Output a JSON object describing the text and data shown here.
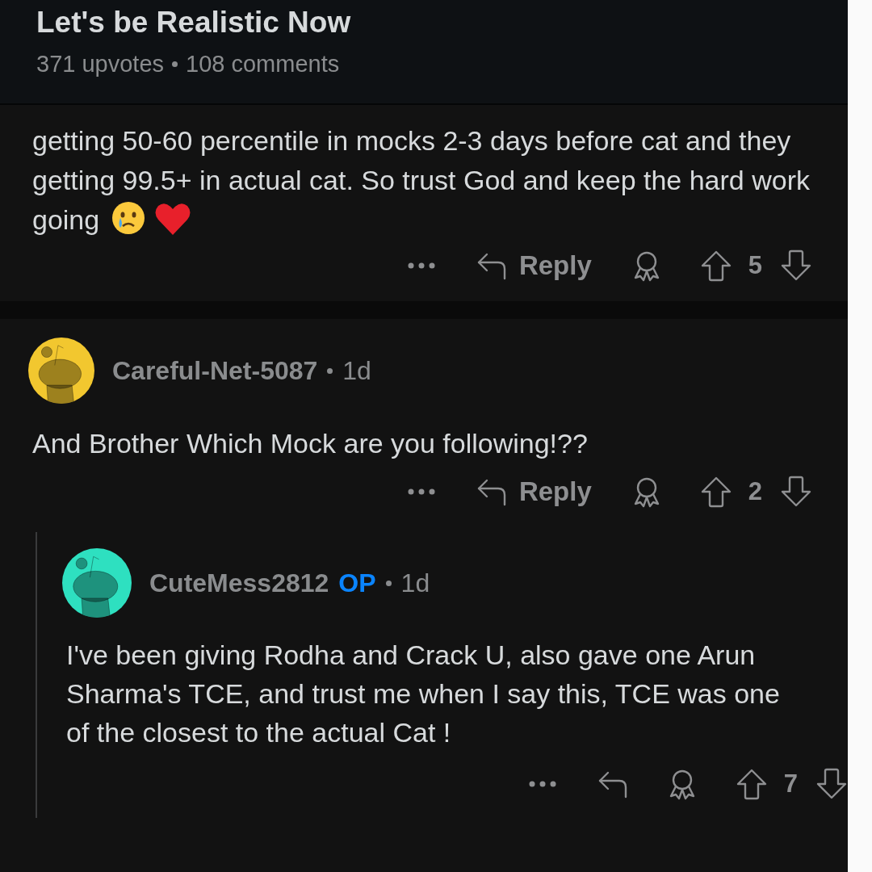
{
  "post": {
    "title": "Let's be Realistic Now",
    "upvotes": "371 upvotes",
    "comments": "108 comments"
  },
  "comments": [
    {
      "kind": "continued",
      "body": "getting 50-60 percentile in mocks 2-3 days before cat and they getting 99.5+ in actual cat. So trust God and keep the hard work going",
      "emoji_icons": true,
      "reply_label": "Reply",
      "score": "5"
    },
    {
      "kind": "full",
      "author": "Careful-Net-5087",
      "color": "#f2c72f",
      "time": "1d",
      "body": "And Brother Which Mock are you following!??",
      "reply_label": "Reply",
      "score": "2",
      "children": [
        {
          "kind": "full",
          "author": "CuteMess2812",
          "op_badge": "OP",
          "color": "#2ee0c0",
          "time": "1d",
          "body": "I've been giving Rodha and Crack U, also gave one Arun Sharma's TCE, and trust me when I say this, TCE was one of the closest to the actual Cat !",
          "score": "7"
        }
      ]
    }
  ]
}
